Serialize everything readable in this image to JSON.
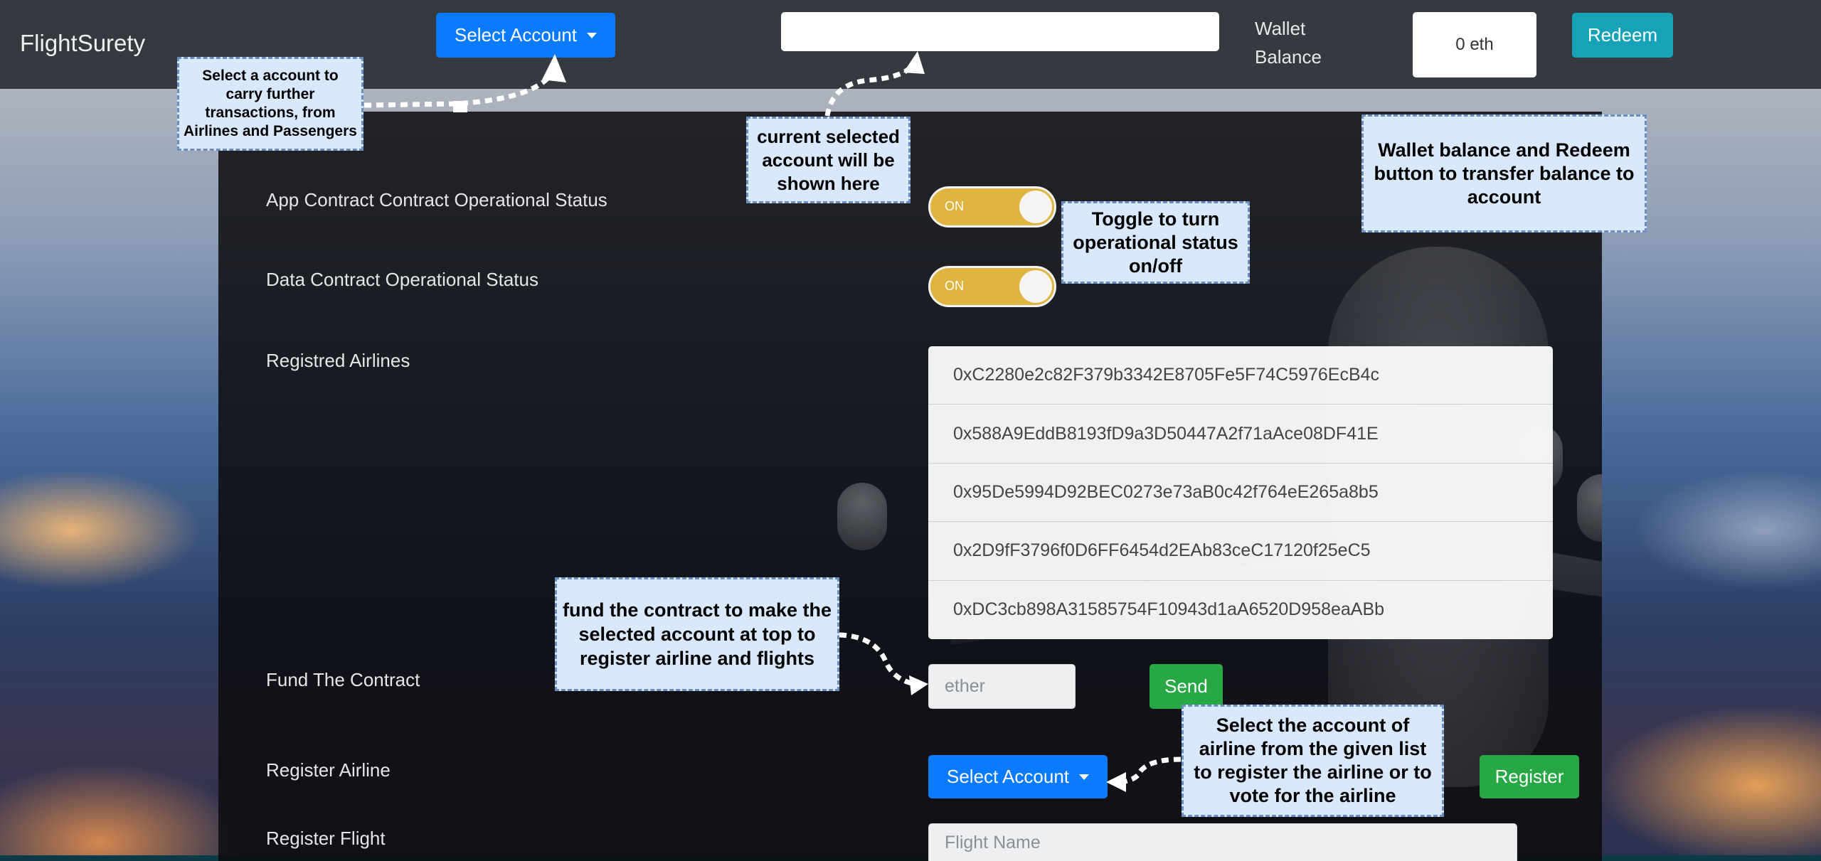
{
  "navbar": {
    "brand": "FlightSurety",
    "select_account_label": "Select Account",
    "current_account": "",
    "wallet_label": "Wallet Balance",
    "wallet_balance": "0 eth",
    "redeem_label": "Redeem"
  },
  "main": {
    "app_status_label": "App Contract Contract Operational Status",
    "app_status_value": "ON",
    "data_status_label": "Data Contract Operational Status",
    "data_status_value": "ON",
    "airlines_label": "Registred Airlines",
    "airlines": [
      "0xC2280e2c82F379b3342E8705Fe5F74C5976EcB4c",
      "0x588A9EddB8193fD9a3D50447A2f71aAce08DF41E",
      "0x95De5994D92BEC0273e73aB0c42f764eE265a8b5",
      "0x2D9fF3796f0D6FF6454d2EAb83ceC17120f25eC5",
      "0xDC3cb898A31585754F10943d1aA6520D958eaABb"
    ],
    "fund_label": "Fund The Contract",
    "fund_placeholder": "ether",
    "send_label": "Send",
    "register_airline_label": "Register Airline",
    "register_select_label": "Select Account",
    "register_button_label": "Register",
    "register_flight_label": "Register Flight",
    "flight_name_placeholder": "Flight Name"
  },
  "annotations": {
    "select_account_note": "Select a account to carry further transactions, from Airlines and Passengers",
    "current_account_note": "current selected account will be shown here",
    "wallet_note": "Wallet balance and Redeem button to transfer balance to account",
    "toggle_note": "Toggle to turn operational status on/off",
    "fund_note": "fund the contract to make the selected account at top to register airline and flights",
    "register_note": "Select the account of airline from the given list to register the airline or to vote for the airline"
  },
  "colors": {
    "navbar": "#343a40",
    "primary": "#0a7bff",
    "info": "#17a2b8",
    "success": "#28a745",
    "toggle_on": "#dfb440",
    "note_fill": "#dae8fc",
    "note_border": "#6c8ebf"
  }
}
